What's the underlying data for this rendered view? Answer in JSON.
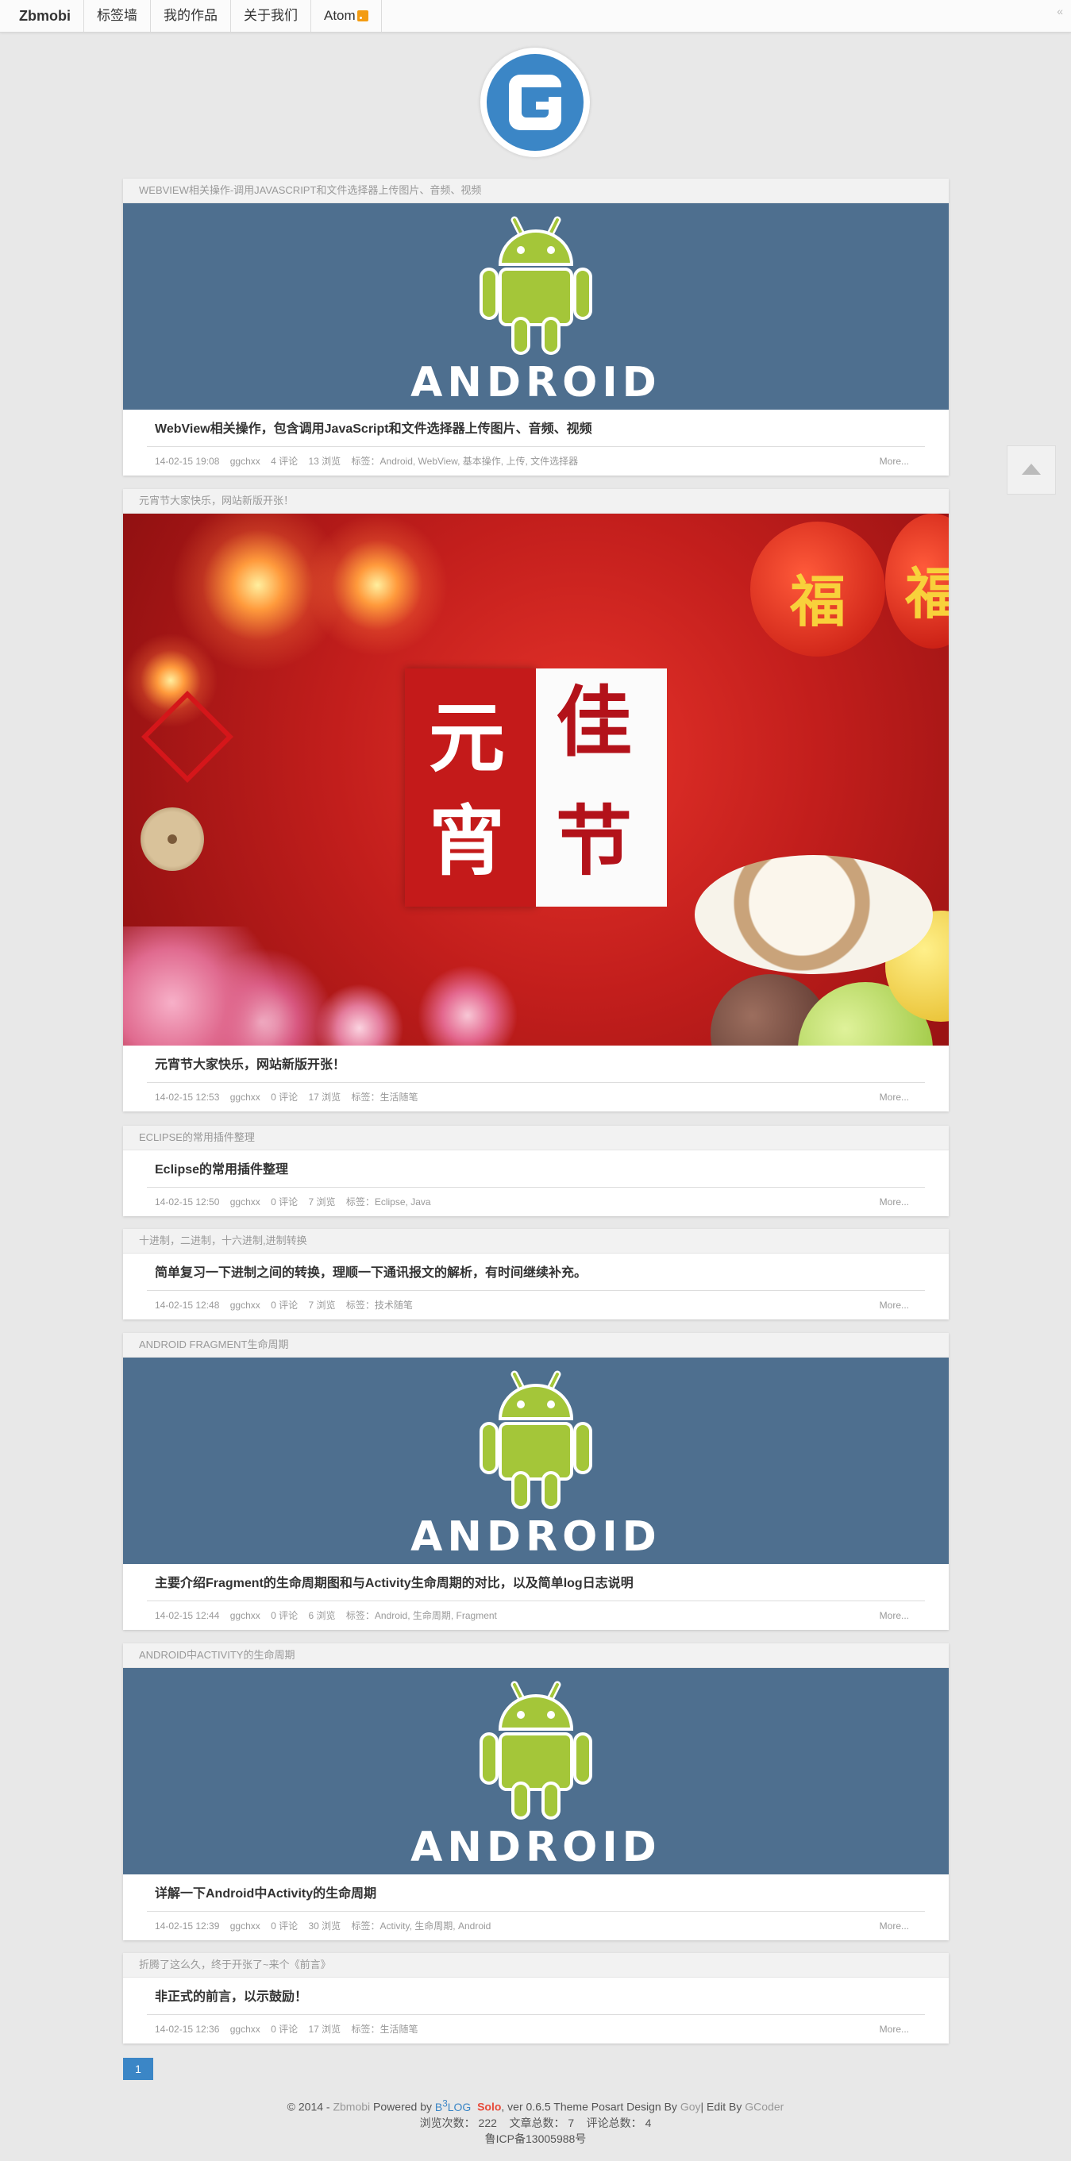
{
  "nav": {
    "brand": "Zbmobi",
    "items": [
      {
        "label": "标签墙"
      },
      {
        "label": "我的作品"
      },
      {
        "label": "关于我们"
      },
      {
        "label": "Atom"
      }
    ]
  },
  "posts": [
    {
      "category": "WebView相关操作-调用JavaScript和文件选择器上传图片、音频、视频",
      "title": "WebView相关操作，包含调用JavaScript和文件选择器上传图片、音频、视频",
      "date": "14-02-15 19:08",
      "author": "ggchxx",
      "comments": "4 评论",
      "views": "13 浏览",
      "tags": "标签：Android, WebView, 基本操作, 上传, 文件选择器",
      "more": "More...",
      "thumb_text": "ANDROID"
    },
    {
      "category": "元宵节大家快乐，网站新版开张！",
      "title": "元宵节大家快乐，网站新版开张！",
      "date": "14-02-15 12:53",
      "author": "ggchxx",
      "comments": "0 评论",
      "views": "17 浏览",
      "tags": "标签：生活随笔",
      "more": "More...",
      "image_chars": [
        "元",
        "佳",
        "宵",
        "节",
        "福",
        "福"
      ]
    },
    {
      "category": "Eclipse的常用插件整理",
      "title": "Eclipse的常用插件整理",
      "date": "14-02-15 12:50",
      "author": "ggchxx",
      "comments": "0 评论",
      "views": "7 浏览",
      "tags": "标签：Eclipse, Java",
      "more": "More..."
    },
    {
      "category": "十进制，二进制，十六进制,进制转换",
      "title": "简单复习一下进制之间的转换，理顺一下通讯报文的解析，有时间继续补充。",
      "date": "14-02-15 12:48",
      "author": "ggchxx",
      "comments": "0 评论",
      "views": "7 浏览",
      "tags": "标签：技术随笔",
      "more": "More..."
    },
    {
      "category": "Android Fragment生命周期",
      "title": "主要介绍Fragment的生命周期图和与Activity生命周期的对比，以及简单log日志说明",
      "date": "14-02-15 12:44",
      "author": "ggchxx",
      "comments": "0 评论",
      "views": "6 浏览",
      "tags": "标签：Android, 生命周期, Fragment",
      "more": "More...",
      "thumb_text": "ANDROID"
    },
    {
      "category": "Android中Activity的生命周期",
      "title": "详解一下Android中Activity的生命周期",
      "date": "14-02-15 12:39",
      "author": "ggchxx",
      "comments": "0 评论",
      "views": "30 浏览",
      "tags": "标签：Activity, 生命周期, Android",
      "more": "More...",
      "thumb_text": "ANDROID"
    },
    {
      "category": "折腾了这么久，终于开张了~来个《前言》",
      "title": "非正式的前言，以示鼓励！",
      "date": "14-02-15 12:36",
      "author": "ggchxx",
      "comments": "0 评论",
      "views": "17 浏览",
      "tags": "标签：生活随笔",
      "more": "More..."
    }
  ],
  "pagination": {
    "current": "1"
  },
  "footer": {
    "copyright": "© 2014 - ",
    "site": "Zbmobi",
    "powered": " Powered by ",
    "b3": "B",
    "sup": "3",
    "log": "LOG",
    "solo": "Solo",
    "version": ", ver 0.6.5   Theme Posart Design By ",
    "goy": "Goy",
    "edit": "| Edit By ",
    "gcoder": "GCoder",
    "stats": "浏览次数： 222    文章总数： 7    评论总数： 4",
    "icp": "鲁ICP备13005988号"
  },
  "colors": {
    "accent": "#3b86c6",
    "android_bg": "#4e6f8f",
    "android_green": "#a4c639"
  },
  "icons": {
    "collapse": "double-chevron-left-icon",
    "back_to_top": "chevron-up-icon",
    "rss": "rss-icon"
  }
}
